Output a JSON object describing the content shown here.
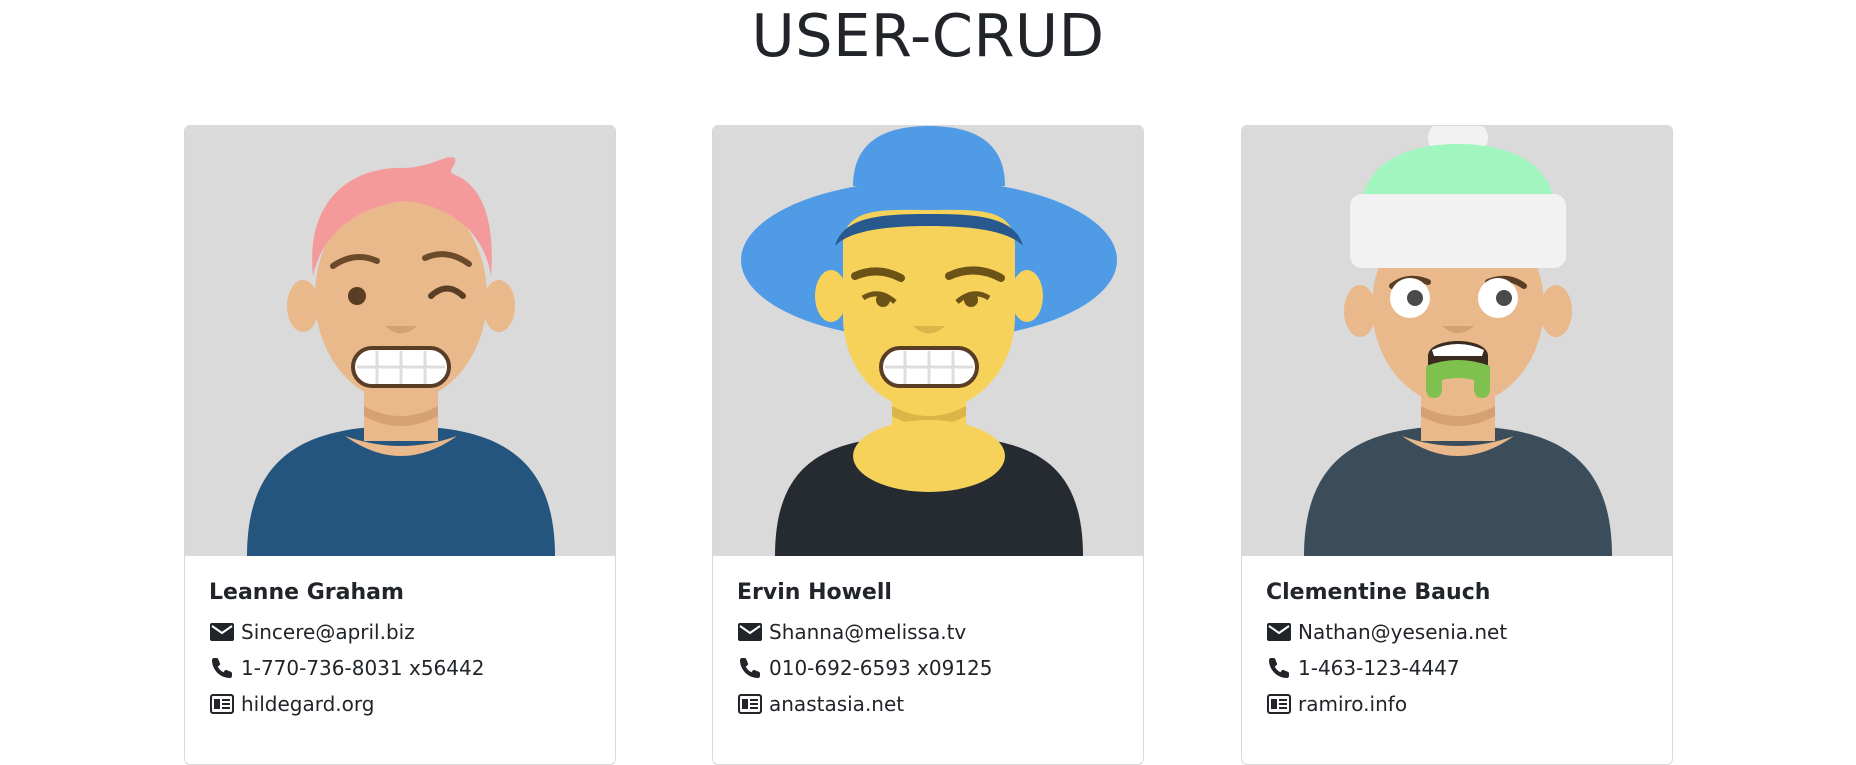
{
  "header": {
    "title": "USER-CRUD"
  },
  "users": [
    {
      "name": "Leanne Graham",
      "email": "Sincere@april.biz",
      "phone": "1-770-736-8031 x56442",
      "website": "hildegard.org"
    },
    {
      "name": "Ervin Howell",
      "email": "Shanna@melissa.tv",
      "phone": "010-692-6593 x09125",
      "website": "anastasia.net"
    },
    {
      "name": "Clementine Bauch",
      "email": "Nathan@yesenia.net",
      "phone": "1-463-123-4447",
      "website": "ramiro.info"
    }
  ],
  "icons": {
    "email": "envelope-icon",
    "phone": "phone-icon",
    "website": "newspaper-icon"
  },
  "colors": {
    "avatar_background": "#dadada",
    "text": "#212529"
  }
}
